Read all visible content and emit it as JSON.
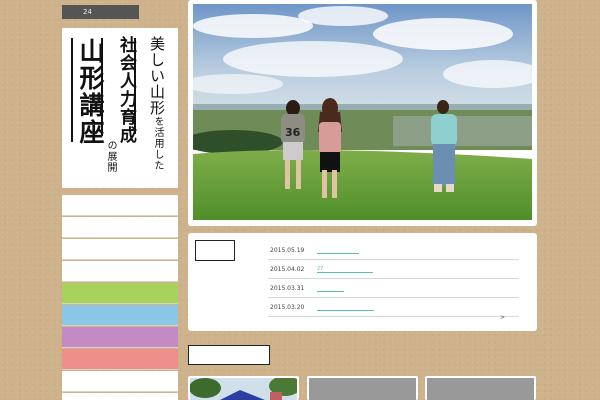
{
  "header": {
    "counter_text": "24"
  },
  "title": {
    "line1_big": "美しい山形",
    "line1_small": "を活用した",
    "line2": "社会人力育成",
    "line3": "山形講座",
    "line4": "の展開"
  },
  "menu": {
    "items": [
      {
        "color": "#ffffff"
      },
      {
        "color": "#ffffff"
      },
      {
        "color": "#ffffff"
      },
      {
        "color": "#ffffff"
      },
      {
        "color": "#a7d35c"
      },
      {
        "color": "#8cc6e6"
      },
      {
        "color": "#c48ac4"
      },
      {
        "color": "#ef8f8c"
      },
      {
        "color": "#ffffff"
      },
      {
        "color": "#ffffff"
      }
    ]
  },
  "news": {
    "items": [
      {
        "date": "2015.05.19",
        "link": ""
      },
      {
        "date": "2015.04.02",
        "link": "27"
      },
      {
        "date": "2015.03.31",
        "link": ""
      },
      {
        "date": "2015.03.20",
        "link": ""
      }
    ],
    "more": ">"
  },
  "colors": {
    "accent": "#5bbfa8",
    "background": "#cdb28c"
  }
}
